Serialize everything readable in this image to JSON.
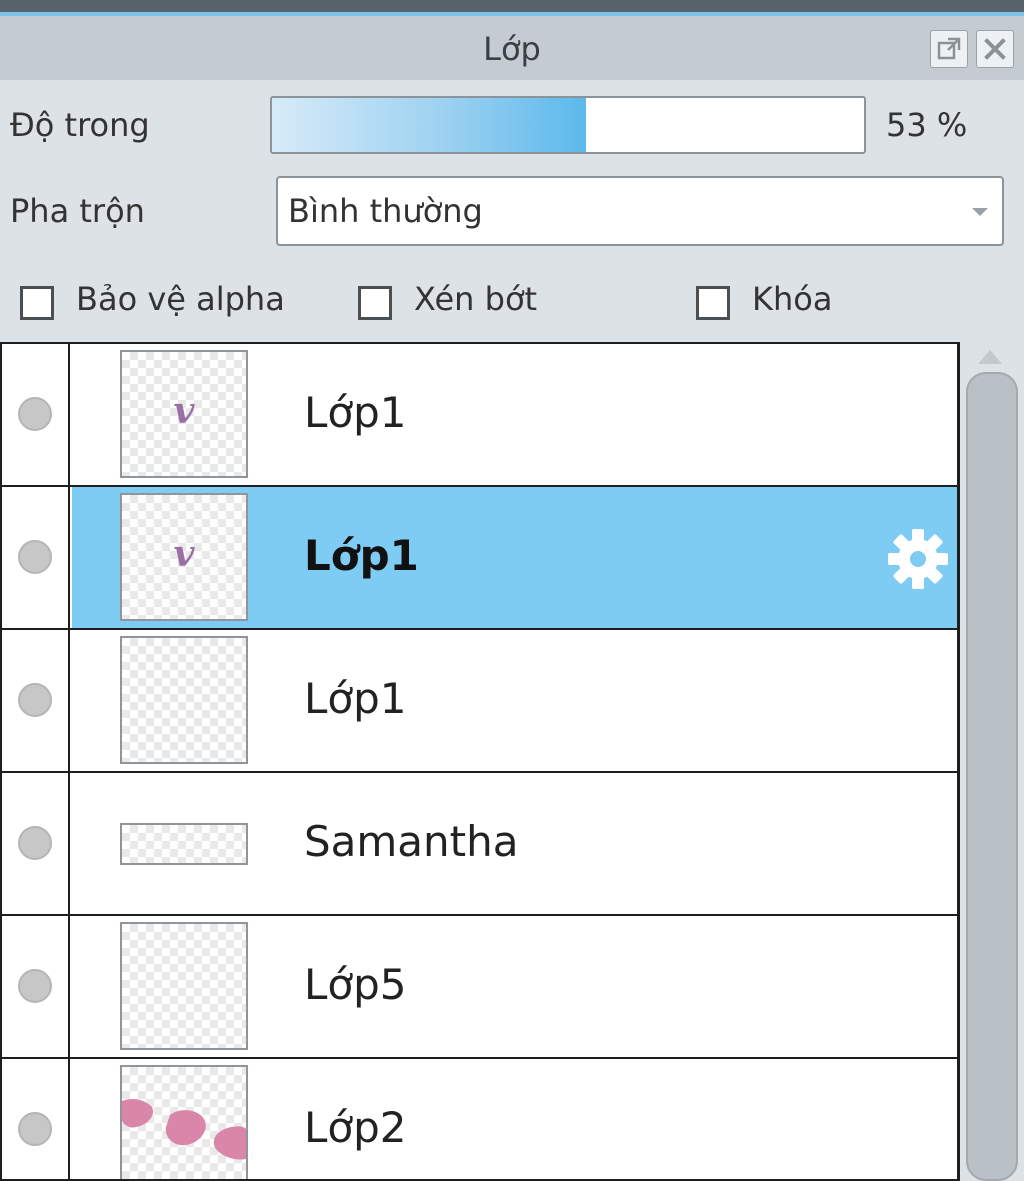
{
  "panel": {
    "title": "Lớp",
    "float_icon": "float-window-icon",
    "close_icon": "close-icon"
  },
  "opacity": {
    "label": "Độ trong",
    "value_text": "53 %",
    "fraction": 0.53
  },
  "blend": {
    "label": "Pha trộn",
    "value": "Bình thường"
  },
  "options": [
    {
      "label": "Bảo vệ alpha",
      "checked": false
    },
    {
      "label": "Xén bớt",
      "checked": false
    },
    {
      "label": "Khóa",
      "checked": false
    }
  ],
  "layers": [
    {
      "name": "Lớp1",
      "selected": false
    },
    {
      "name": "Lớp1",
      "selected": true,
      "icon": "gear-icon"
    },
    {
      "name": "Lớp1",
      "selected": false
    },
    {
      "name": "Samantha",
      "selected": false
    },
    {
      "name": "Lớp5",
      "selected": false
    },
    {
      "name": "Lớp2",
      "selected": false
    }
  ],
  "colors": {
    "selected_row": "#7ecbf3",
    "accent": "#7cc4ea"
  }
}
